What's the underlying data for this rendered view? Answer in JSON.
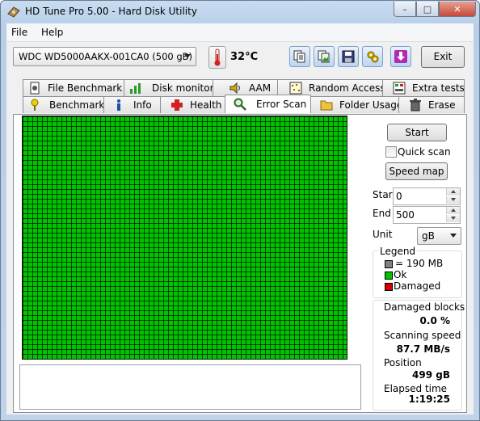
{
  "window": {
    "title": "HD Tune Pro 5.00 - Hard Disk Utility"
  },
  "menu": {
    "file": "File",
    "help": "Help"
  },
  "toolbar": {
    "drive": "WDC WD5000AAKX-001CA0 (500 gB)",
    "temperature": "32°C",
    "exit": "Exit",
    "icons": [
      "copy-text-icon",
      "copy-screenshot-icon",
      "save-icon",
      "options-icon",
      "download-icon"
    ]
  },
  "tabs_top": [
    "File Benchmark",
    "Disk monitor",
    "AAM",
    "Random Access",
    "Extra tests"
  ],
  "tabs_bottom": [
    "Benchmark",
    "Info",
    "Health",
    "Error Scan",
    "Folder Usage",
    "Erase"
  ],
  "active_tab": "Error Scan",
  "scan": {
    "start_button": "Start",
    "quick_scan_label": "Quick scan",
    "quick_scan_checked": false,
    "speed_map_button": "Speed map",
    "start_label": "Start",
    "start_value": "0",
    "end_label": "End",
    "end_value": "500",
    "unit_label": "Unit",
    "unit_value": "gB"
  },
  "legend": {
    "title": "Legend",
    "block_size": "= 190 MB",
    "ok": "Ok",
    "damaged": "Damaged",
    "colors": {
      "block": "#808080",
      "ok": "#00c400",
      "damaged": "#d00000"
    }
  },
  "stats": {
    "damaged_blocks_label": "Damaged blocks",
    "damaged_blocks_value": "0.0 %",
    "scanning_speed_label": "Scanning speed",
    "scanning_speed_value": "87.7 MB/s",
    "position_label": "Position",
    "position_value": "499 gB",
    "elapsed_label": "Elapsed time",
    "elapsed_value": "1:19:25"
  },
  "log_text": ""
}
